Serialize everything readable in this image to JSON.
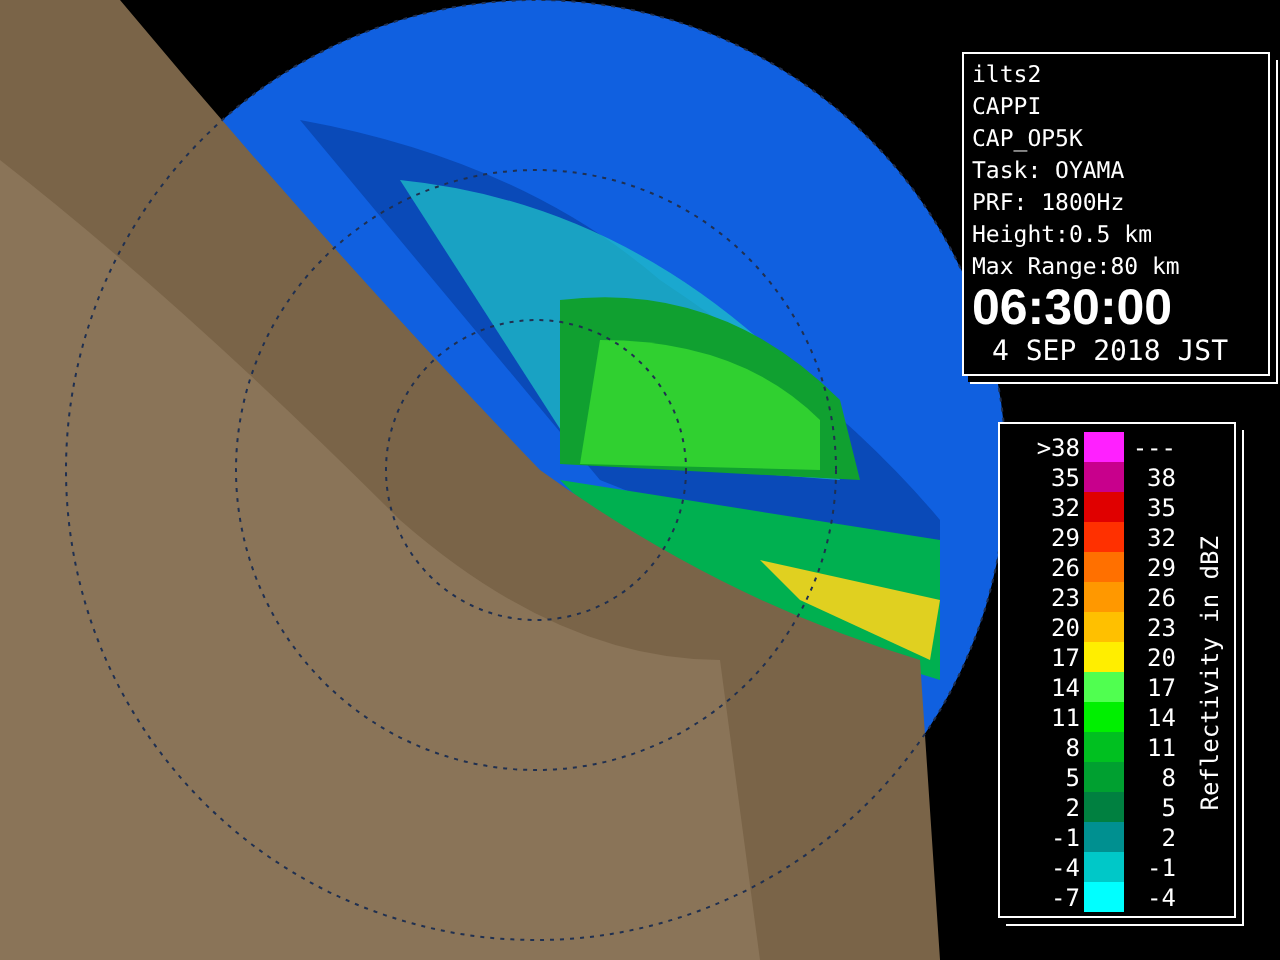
{
  "info_panel": {
    "lines": [
      "ilts2",
      "CAPPI",
      "CAP_OP5K",
      "Task: OYAMA",
      "PRF: 1800Hz",
      "Height:0.5 km",
      "Max Range:80 km"
    ],
    "time": "06:30:00",
    "date": "4 SEP 2018 JST"
  },
  "legend": {
    "title": "Reflectivity in dBZ",
    "rows": [
      {
        "low": ">38",
        "high": "---",
        "color": "#ff20ff"
      },
      {
        "low": "35",
        "high": "38",
        "color": "#c8008c"
      },
      {
        "low": "32",
        "high": "35",
        "color": "#e00000"
      },
      {
        "low": "29",
        "high": "32",
        "color": "#ff3000"
      },
      {
        "low": "26",
        "high": "29",
        "color": "#ff7000"
      },
      {
        "low": "23",
        "high": "26",
        "color": "#ff9800"
      },
      {
        "low": "20",
        "high": "23",
        "color": "#ffc000"
      },
      {
        "low": "17",
        "high": "20",
        "color": "#ffee00"
      },
      {
        "low": "14",
        "high": "17",
        "color": "#50ff50"
      },
      {
        "low": "11",
        "high": "14",
        "color": "#00f000"
      },
      {
        "low": "8",
        "high": "11",
        "color": "#00c020"
      },
      {
        "low": "5",
        "high": "8",
        "color": "#00a030"
      },
      {
        "low": "2",
        "high": "5",
        "color": "#008040"
      },
      {
        "low": "-1",
        "high": "2",
        "color": "#009090"
      },
      {
        "low": "-4",
        "high": "-1",
        "color": "#00c8c8"
      },
      {
        "low": "-7",
        "high": "-4",
        "color": "#00ffff"
      }
    ]
  }
}
